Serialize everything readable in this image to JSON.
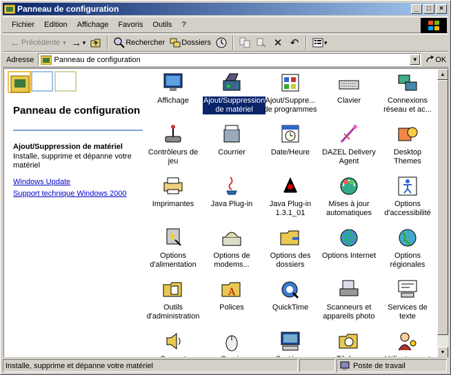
{
  "window": {
    "title": "Panneau de configuration"
  },
  "title_buttons": {
    "minimize": "_",
    "maximize": "□",
    "close": "×"
  },
  "menu": [
    {
      "label": "Fichier",
      "name": "menu-fichier"
    },
    {
      "label": "Edition",
      "name": "menu-edition"
    },
    {
      "label": "Affichage",
      "name": "menu-affichage"
    },
    {
      "label": "Favoris",
      "name": "menu-favoris"
    },
    {
      "label": "Outils",
      "name": "menu-outils"
    },
    {
      "label": "?",
      "name": "menu-aide"
    }
  ],
  "toolbar": {
    "back_label": "Précédente",
    "back_arrow": "←",
    "forward_arrow": "→",
    "dropdown_arrow": "▾",
    "search_label": "Rechercher",
    "folders_label": "Dossiers",
    "delete_glyph": "✕",
    "undo_glyph": "↶"
  },
  "address": {
    "label": "Adresse",
    "value": "Panneau de configuration",
    "go_label": "OK",
    "dropdown_arrow": "▼"
  },
  "left_pane": {
    "title": "Panneau de configuration",
    "item_title": "Ajout/Suppression de matériel",
    "item_desc": "Installe, supprime et dépanne votre matériel",
    "links": [
      "Windows Update",
      "Support technique Windows 2000"
    ]
  },
  "icons": [
    {
      "label": "Affichage",
      "icon": "display-icon"
    },
    {
      "label": "Ajout/Suppression de matériel",
      "icon": "add-hardware-icon",
      "selected": true
    },
    {
      "label": "Ajout/Suppre... de programmes",
      "icon": "add-remove-programs-icon"
    },
    {
      "label": "Clavier",
      "icon": "keyboard-icon"
    },
    {
      "label": "Connexions réseau et ac...",
      "icon": "network-connections-icon"
    },
    {
      "label": "Contrôleurs de jeu",
      "icon": "game-controllers-icon"
    },
    {
      "label": "Courrier",
      "icon": "mail-icon"
    },
    {
      "label": "Date/Heure",
      "icon": "date-time-icon"
    },
    {
      "label": "DAZEL Delivery Agent",
      "icon": "dazel-icon"
    },
    {
      "label": "Desktop Themes",
      "icon": "desktop-themes-icon"
    },
    {
      "label": "Imprimantes",
      "icon": "printers-icon"
    },
    {
      "label": "Java Plug-in",
      "icon": "java-icon"
    },
    {
      "label": "Java Plug-in 1.3.1_01",
      "icon": "java-duke-icon"
    },
    {
      "label": "Mises à jour automatiques",
      "icon": "auto-update-icon"
    },
    {
      "label": "Options d'accessibilité",
      "icon": "accessibility-icon"
    },
    {
      "label": "Options d'alimentation",
      "icon": "power-options-icon"
    },
    {
      "label": "Options de modems...",
      "icon": "modem-icon"
    },
    {
      "label": "Options des dossiers",
      "icon": "folder-options-icon"
    },
    {
      "label": "Options Internet",
      "icon": "internet-options-icon"
    },
    {
      "label": "Options régionales",
      "icon": "regional-options-icon"
    },
    {
      "label": "Outils d'administration",
      "icon": "admin-tools-icon"
    },
    {
      "label": "Polices",
      "icon": "fonts-icon"
    },
    {
      "label": "QuickTime",
      "icon": "quicktime-icon"
    },
    {
      "label": "Scanneurs et appareils photo",
      "icon": "scanner-icon"
    },
    {
      "label": "Services de texte",
      "icon": "text-services-icon"
    },
    {
      "label": "Sons et",
      "icon": "sounds-icon"
    },
    {
      "label": "Souris",
      "icon": "mouse-icon"
    },
    {
      "label": "Système",
      "icon": "system-icon"
    },
    {
      "label": "Tâches",
      "icon": "scheduled-tasks-icon"
    },
    {
      "label": "Utilisateurs et",
      "icon": "users-icon"
    }
  ],
  "status": {
    "text": "Installe, supprime et dépanne votre matériel",
    "zone": "Poste de travail"
  },
  "colors": {
    "titlebar_start": "#0a246a",
    "titlebar_end": "#a6caf0",
    "selection": "#0a246a",
    "link": "#0000cc"
  }
}
